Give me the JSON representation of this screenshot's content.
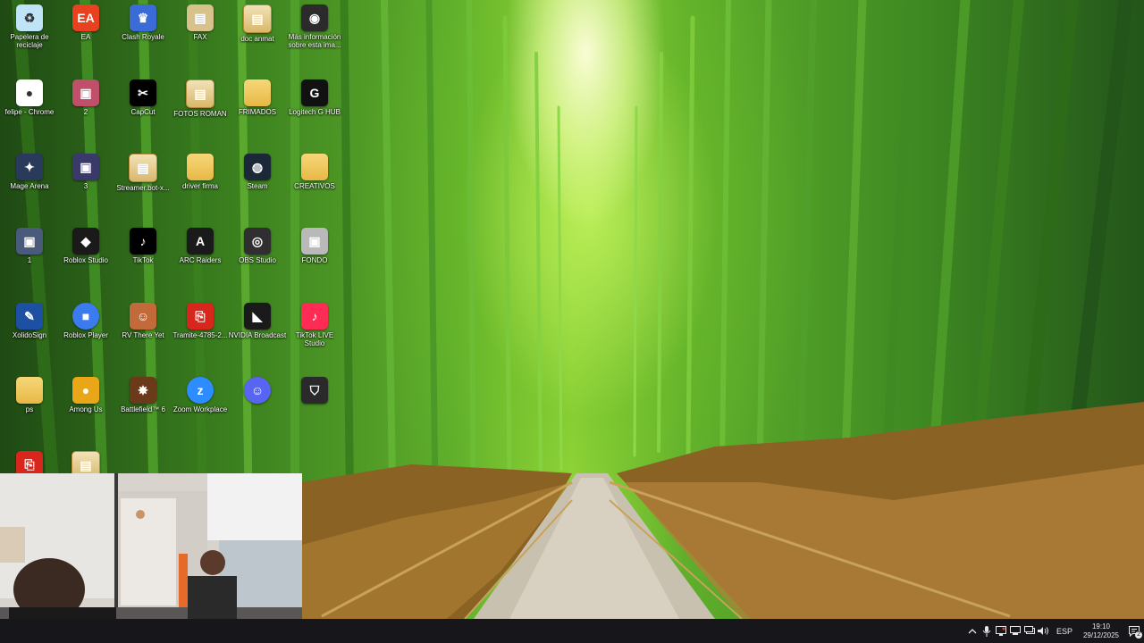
{
  "desktop": {
    "icons": [
      {
        "label": "Papelera de reciclaje",
        "icon": "recycle-bin-icon",
        "color": "#bfe3f7"
      },
      {
        "label": "EA",
        "icon": "ea-icon",
        "color": "#e8411f"
      },
      {
        "label": "Clash Royale",
        "icon": "clash-royale-icon",
        "color": "#3b6bd6"
      },
      {
        "label": "FAX",
        "icon": "fax-icon",
        "color": "#d6c28a"
      },
      {
        "label": "doc anmat",
        "icon": "document-icon",
        "color": "#e4c98a"
      },
      {
        "label": "Más información sobre esta ima...",
        "icon": "camera-icon",
        "color": "#2b2b2b"
      },
      {
        "label": "felipe - Chrome",
        "icon": "chrome-icon",
        "color": "#ffffff"
      },
      {
        "label": "2",
        "icon": "image-file-icon",
        "color": "#c0506a"
      },
      {
        "label": "CapCut",
        "icon": "capcut-icon",
        "color": "#000000"
      },
      {
        "label": "FOTOS ROMAN",
        "icon": "document-icon",
        "color": "#e4c98a"
      },
      {
        "label": "FRIMADOS",
        "icon": "folder-icon",
        "color": "#f1c94f"
      },
      {
        "label": "Logitech G HUB",
        "icon": "logitech-icon",
        "color": "#111111"
      },
      {
        "label": "Mage Arena",
        "icon": "mage-arena-icon",
        "color": "#2a3a5a"
      },
      {
        "label": "3",
        "icon": "image-file-icon",
        "color": "#3a3a6a"
      },
      {
        "label": "Streamer.bot-x...",
        "icon": "document-icon",
        "color": "#e4c98a"
      },
      {
        "label": "driver firma",
        "icon": "folder-icon",
        "color": "#f1c94f"
      },
      {
        "label": "Steam",
        "icon": "steam-icon",
        "color": "#1b2838"
      },
      {
        "label": "CREATIVOS",
        "icon": "folder-icon",
        "color": "#d9c987"
      },
      {
        "label": "1",
        "icon": "image-file-icon",
        "color": "#4a5a7a"
      },
      {
        "label": "Roblox Studio",
        "icon": "roblox-studio-icon",
        "color": "#1a1a1a"
      },
      {
        "label": "TikTok",
        "icon": "tiktok-icon",
        "color": "#000000"
      },
      {
        "label": "ARC Raiders",
        "icon": "arc-raiders-icon",
        "color": "#1a1a1a"
      },
      {
        "label": "OBS Studio",
        "icon": "obs-icon",
        "color": "#302e31"
      },
      {
        "label": "FONDO",
        "icon": "image-file-icon",
        "color": "#b9b9b9"
      },
      {
        "label": "XolidoSign",
        "icon": "xolidosign-icon",
        "color": "#1d4fa3"
      },
      {
        "label": "Roblox Player",
        "icon": "roblox-icon",
        "color": "#3a7bf0"
      },
      {
        "label": "RV There Yet",
        "icon": "rv-there-yet-icon",
        "color": "#c26a3a"
      },
      {
        "label": "Tramite-4785-2...",
        "icon": "pdf-icon",
        "color": "#d8261c"
      },
      {
        "label": "NVIDIA Broadcast",
        "icon": "nvidia-icon",
        "color": "#1a1a1a"
      },
      {
        "label": "TikTok LIVE Studio",
        "icon": "tiktok-live-icon",
        "color": "#fe2c55"
      },
      {
        "label": "ps",
        "icon": "folder-icon",
        "color": "#d9c987"
      },
      {
        "label": "Among Us",
        "icon": "among-us-icon",
        "color": "#e8a618"
      },
      {
        "label": "Battlefield™ 6",
        "icon": "battlefield-icon",
        "color": "#6a3a1a"
      },
      {
        "label": "Zoom Workplace",
        "icon": "zoom-icon",
        "color": "#2d8cff"
      },
      {
        "label": "",
        "icon": "discord-icon",
        "color": "#5865f2"
      },
      {
        "label": "",
        "icon": "shield-app-icon",
        "color": "#2a2a2a"
      },
      {
        "label": "",
        "icon": "pdf-icon",
        "color": "#d8261c"
      },
      {
        "label": "",
        "icon": "document-icon",
        "color": "#e4c98a"
      }
    ]
  },
  "taskbar": {
    "language": "ESP",
    "time": "19:10",
    "date": "29/12/2025",
    "notification_count": "2",
    "tray_icons": [
      "chevron-up-icon",
      "microphone-icon",
      "monitor-icon",
      "network-icon",
      "display-icon",
      "volume-icon"
    ]
  }
}
